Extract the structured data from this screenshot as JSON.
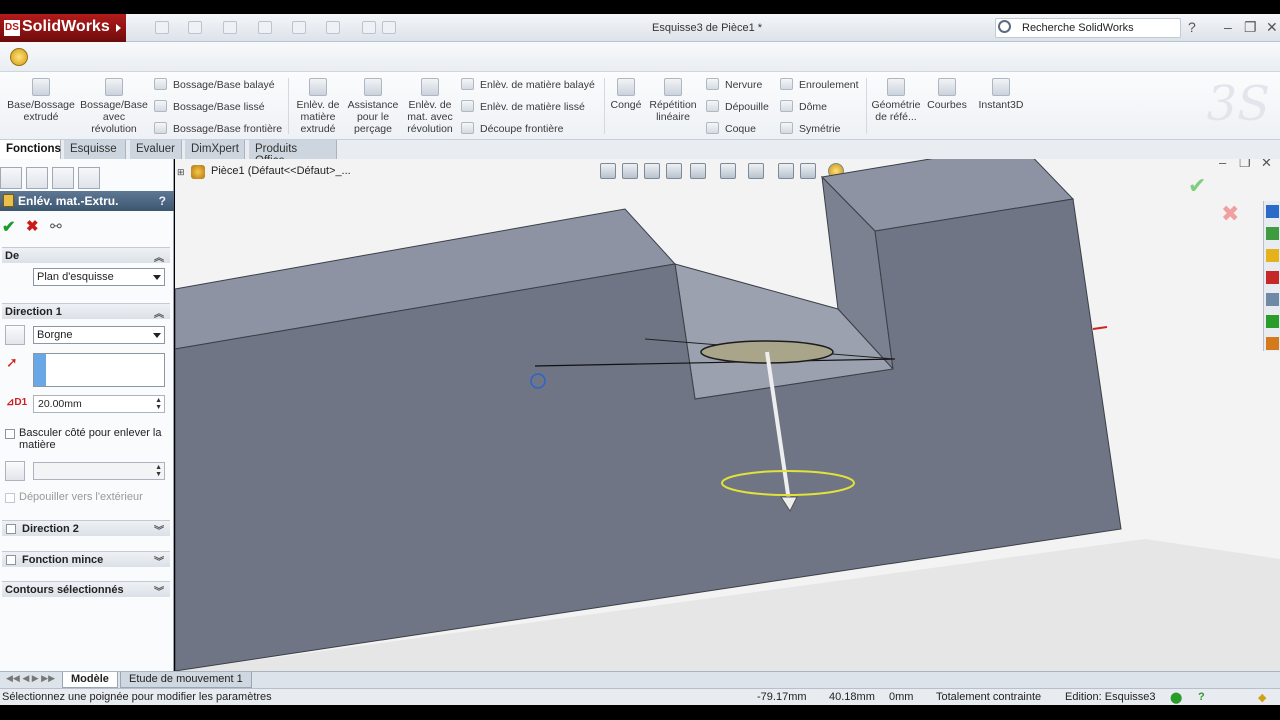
{
  "app": {
    "logo": "SolidWorks",
    "window_title": "Esquisse3 de Pièce1 *",
    "search_label": "Recherche SolidWorks"
  },
  "command_manager": {
    "big": [
      {
        "label": "Base/Bossage extrudé"
      },
      {
        "label": "Bossage/Base avec révolution"
      },
      {
        "label": "Enlèv. de matière extrudé"
      },
      {
        "label": "Assistance pour le perçage"
      },
      {
        "label": "Enlèv. de mat. avec révolution"
      },
      {
        "label": "Congé"
      },
      {
        "label": "Répétition linéaire"
      },
      {
        "label": "Géométrie de réfé..."
      },
      {
        "label": "Courbes"
      },
      {
        "label": "Instant3D"
      }
    ],
    "small": [
      {
        "label": "Bossage/Base balayé"
      },
      {
        "label": "Bossage/Base lissé"
      },
      {
        "label": "Bossage/Base frontière"
      },
      {
        "label": "Enlèv. de matière balayé"
      },
      {
        "label": "Enlèv. de matière lissé"
      },
      {
        "label": "Découpe frontière"
      },
      {
        "label": "Nervure"
      },
      {
        "label": "Dépouille"
      },
      {
        "label": "Coque"
      },
      {
        "label": "Enroulement"
      },
      {
        "label": "Dôme"
      },
      {
        "label": "Symétrie"
      }
    ]
  },
  "tabs": [
    "Fonctions",
    "Esquisse",
    "Evaluer",
    "DimXpert",
    "Produits Office"
  ],
  "panel": {
    "title": "Enlév. mat.-Extru.",
    "help": "?",
    "de_group": "De",
    "de_value": "Plan d'esquisse",
    "direction1": "Direction 1",
    "direction1_type": "Borgne",
    "depth": "20.00mm",
    "flip_side": "Basculer côté pour enlever la matière",
    "draft_outward": "Dépouiller vers l'extérieur",
    "direction2": "Direction 2",
    "thin_feature": "Fonction mince",
    "selected_contours": "Contours sélectionnés"
  },
  "viewport": {
    "tree_label": "Pièce1  (Défaut<<Défaut>_..."
  },
  "model_tabs": [
    "Modèle",
    "Etude de mouvement 1"
  ],
  "status": {
    "hint": "Sélectionnez une poignée pour modifier les paramètres",
    "x": "-79.17mm",
    "y": "40.18mm",
    "z": "0mm",
    "state": "Totalement contrainte",
    "editing": "Edition: Esquisse3"
  },
  "colors": {
    "part_face_dark": "#6f7584",
    "part_face_top": "#8d93a2",
    "accent_blue": "#3d5670",
    "sketch_yellow": "#e1e23a"
  }
}
